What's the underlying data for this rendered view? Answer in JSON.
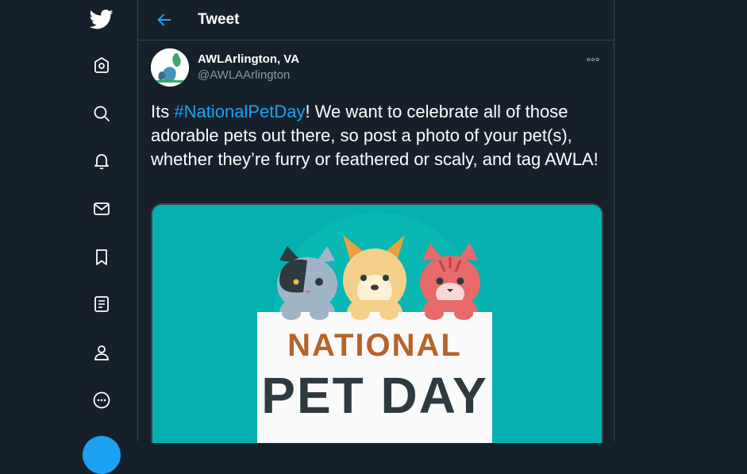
{
  "sidebar": {
    "items": [
      {
        "name": "twitter-logo-icon"
      },
      {
        "name": "home-icon"
      },
      {
        "name": "explore-icon"
      },
      {
        "name": "notifications-icon"
      },
      {
        "name": "messages-icon"
      },
      {
        "name": "bookmarks-icon"
      },
      {
        "name": "lists-icon"
      },
      {
        "name": "profile-icon"
      },
      {
        "name": "more-icon"
      }
    ]
  },
  "header": {
    "title": "Tweet",
    "back_icon": "arrow-left-icon"
  },
  "tweet": {
    "display_name": "AWLArlington, VA",
    "handle": "@AWLAArlington",
    "text_before": "Its ",
    "hashtag": "#NationalPetDay",
    "text_after": "! We want to celebrate all of those adorable pets out there, so post a photo of your pet(s), whether they’re furry or feathered or scaly, and tag AWLA!",
    "media": {
      "line1": "NATIONAL",
      "line2": "PET DAY"
    }
  },
  "colors": {
    "background": "#15202b",
    "border": "#38444d",
    "accent": "#1da1f2",
    "secondary_text": "#8899a6",
    "media_teal": "#05b1ae",
    "media_orange": "#b8622a",
    "media_dark": "#2d3a3f"
  }
}
